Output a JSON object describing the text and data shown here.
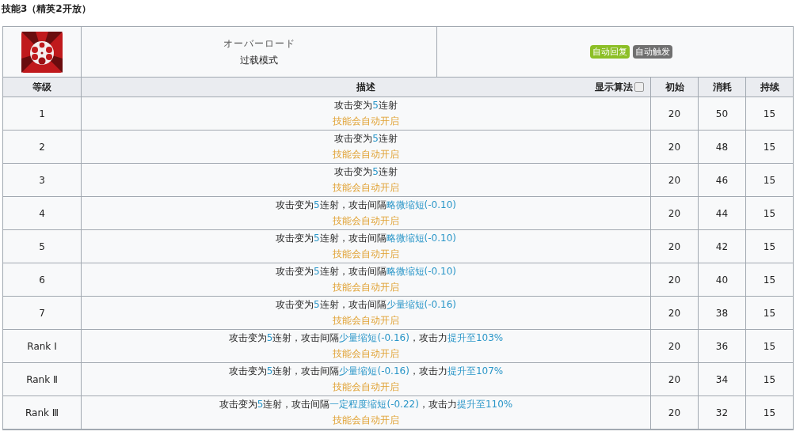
{
  "section_title": "技能3（精英2开放）",
  "skill": {
    "name_jp": "オーバーロード",
    "name": "过载模式",
    "tags": [
      {
        "label": "自动回复",
        "color": "#8cbf26"
      },
      {
        "label": "自动触发",
        "color": "#707070"
      }
    ]
  },
  "table": {
    "columns": [
      {
        "label": "等级"
      },
      {
        "label": "描述"
      },
      {
        "label": "初始"
      },
      {
        "label": "消耗"
      },
      {
        "label": "持续"
      }
    ],
    "formula_toggle": {
      "label": "显示算法",
      "checked": false
    },
    "rows": [
      {
        "level": "1",
        "desc": [
          {
            "text": "攻击变为",
            "kind": "plain"
          },
          {
            "text": "5",
            "kind": "value"
          },
          {
            "text": "连射",
            "kind": "plain"
          }
        ],
        "note": "技能会自动开启",
        "initial": "20",
        "cost": "50",
        "duration": "15"
      },
      {
        "level": "2",
        "desc": [
          {
            "text": "攻击变为",
            "kind": "plain"
          },
          {
            "text": "5",
            "kind": "value"
          },
          {
            "text": "连射",
            "kind": "plain"
          }
        ],
        "note": "技能会自动开启",
        "initial": "20",
        "cost": "48",
        "duration": "15"
      },
      {
        "level": "3",
        "desc": [
          {
            "text": "攻击变为",
            "kind": "plain"
          },
          {
            "text": "5",
            "kind": "value"
          },
          {
            "text": "连射",
            "kind": "plain"
          }
        ],
        "note": "技能会自动开启",
        "initial": "20",
        "cost": "46",
        "duration": "15"
      },
      {
        "level": "4",
        "desc": [
          {
            "text": "攻击变为",
            "kind": "plain"
          },
          {
            "text": "5",
            "kind": "value"
          },
          {
            "text": "连射，攻击间隔",
            "kind": "plain"
          },
          {
            "text": "略微缩短(-0.10)",
            "kind": "value"
          }
        ],
        "note": "技能会自动开启",
        "initial": "20",
        "cost": "44",
        "duration": "15"
      },
      {
        "level": "5",
        "desc": [
          {
            "text": "攻击变为",
            "kind": "plain"
          },
          {
            "text": "5",
            "kind": "value"
          },
          {
            "text": "连射，攻击间隔",
            "kind": "plain"
          },
          {
            "text": "略微缩短(-0.10)",
            "kind": "value"
          }
        ],
        "note": "技能会自动开启",
        "initial": "20",
        "cost": "42",
        "duration": "15"
      },
      {
        "level": "6",
        "desc": [
          {
            "text": "攻击变为",
            "kind": "plain"
          },
          {
            "text": "5",
            "kind": "value"
          },
          {
            "text": "连射，攻击间隔",
            "kind": "plain"
          },
          {
            "text": "略微缩短(-0.10)",
            "kind": "value"
          }
        ],
        "note": "技能会自动开启",
        "initial": "20",
        "cost": "40",
        "duration": "15"
      },
      {
        "level": "7",
        "desc": [
          {
            "text": "攻击变为",
            "kind": "plain"
          },
          {
            "text": "5",
            "kind": "value"
          },
          {
            "text": "连射，攻击间隔",
            "kind": "plain"
          },
          {
            "text": "少量缩短(-0.16)",
            "kind": "value"
          }
        ],
        "note": "技能会自动开启",
        "initial": "20",
        "cost": "38",
        "duration": "15"
      },
      {
        "level": "Rank Ⅰ",
        "desc": [
          {
            "text": "攻击变为",
            "kind": "plain"
          },
          {
            "text": "5",
            "kind": "value"
          },
          {
            "text": "连射，攻击间隔",
            "kind": "plain"
          },
          {
            "text": "少量缩短(-0.16)",
            "kind": "value"
          },
          {
            "text": "，攻击力",
            "kind": "plain"
          },
          {
            "text": "提升至103%",
            "kind": "value"
          }
        ],
        "note": "技能会自动开启",
        "initial": "20",
        "cost": "36",
        "duration": "15"
      },
      {
        "level": "Rank Ⅱ",
        "desc": [
          {
            "text": "攻击变为",
            "kind": "plain"
          },
          {
            "text": "5",
            "kind": "value"
          },
          {
            "text": "连射，攻击间隔",
            "kind": "plain"
          },
          {
            "text": "少量缩短(-0.16)",
            "kind": "value"
          },
          {
            "text": "，攻击力",
            "kind": "plain"
          },
          {
            "text": "提升至107%",
            "kind": "value"
          }
        ],
        "note": "技能会自动开启",
        "initial": "20",
        "cost": "34",
        "duration": "15"
      },
      {
        "level": "Rank Ⅲ",
        "desc": [
          {
            "text": "攻击变为",
            "kind": "plain"
          },
          {
            "text": "5",
            "kind": "value"
          },
          {
            "text": "连射，攻击间隔",
            "kind": "plain"
          },
          {
            "text": "一定程度缩短(-0.22)",
            "kind": "value"
          },
          {
            "text": "，攻击力",
            "kind": "plain"
          },
          {
            "text": "提升至110%",
            "kind": "value"
          }
        ],
        "note": "技能会自动开启",
        "initial": "20",
        "cost": "32",
        "duration": "15"
      }
    ]
  }
}
